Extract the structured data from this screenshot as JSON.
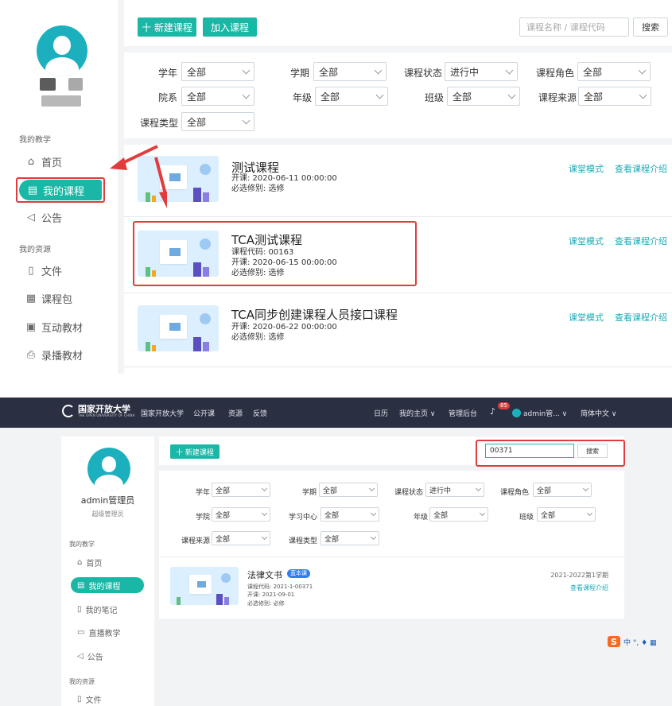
{
  "top": {
    "sidebar": {
      "section_teaching": "我的教学",
      "items": [
        {
          "label": "首页",
          "icon": "home-icon"
        },
        {
          "label": "我的课程",
          "icon": "course-icon",
          "active": true
        },
        {
          "label": "公告",
          "icon": "announcement-icon"
        }
      ],
      "section_resources": "我的资源",
      "resource_items": [
        {
          "label": "文件",
          "icon": "file-icon"
        },
        {
          "label": "课程包",
          "icon": "package-icon"
        },
        {
          "label": "互动教材",
          "icon": "interactive-icon"
        },
        {
          "label": "录播教材",
          "icon": "recording-icon"
        }
      ]
    },
    "toolbar": {
      "new_course": "十 新建课程",
      "join_course": "加入课程",
      "search_placeholder": "课程名称 / 课程代码",
      "search_btn": "搜索"
    },
    "filters": {
      "year_label": "学年",
      "year_value": "全部",
      "term_label": "学期",
      "term_value": "全部",
      "status_label": "课程状态",
      "status_value": "进行中",
      "role_label": "课程角色",
      "role_value": "全部",
      "dept_label": "院系",
      "dept_value": "全部",
      "grade_label": "年级",
      "grade_value": "全部",
      "class_label": "班级",
      "class_value": "全部",
      "source_label": "课程来源",
      "source_value": "全部",
      "type_label": "课程类型",
      "type_value": "全部"
    },
    "courses": [
      {
        "title": "测试课程",
        "code": "",
        "start": "开课: 2020-06-11 00:00:00",
        "required": "必选修别: 选修"
      },
      {
        "title": "TCA测试课程",
        "code": "课程代码: 00163",
        "start": "开课: 2020-06-15 00:00:00",
        "required": "必选修别: 选修"
      },
      {
        "title": "TCA同步创建课程人员接口课程",
        "code": "",
        "start": "开课: 2020-06-22 00:00:00",
        "required": "必选修别: 选修"
      }
    ],
    "links": {
      "classroom": "课堂模式",
      "intro": "查看课程介绍"
    }
  },
  "bottom": {
    "nav": {
      "logo": "国家开放大学",
      "logo_sub": "THE OPEN UNIVERSITY OF CHINA",
      "links": [
        "国家开放大学",
        "公开课",
        "资源",
        "反馈"
      ],
      "calendar": "日历",
      "my_home": "我的主页 ∨",
      "admin_backend": "管理后台",
      "badge": "85",
      "user": "admin管... ∨",
      "lang": "简体中文 ∨"
    },
    "profile": {
      "name": "admin管理员",
      "role": "超级管理员"
    },
    "sidebar": {
      "section_teaching": "我的教学",
      "items": [
        {
          "label": "首页"
        },
        {
          "label": "我的课程"
        },
        {
          "label": "我的笔记"
        },
        {
          "label": "直播教学"
        },
        {
          "label": "公告"
        }
      ],
      "section_resources": "我的资源",
      "resource_items": [
        {
          "label": "文件"
        }
      ]
    },
    "toolbar": {
      "new_course": "十 新建课程",
      "search_value": "00371",
      "search_btn": "搜索"
    },
    "filters": {
      "year_label": "学年",
      "year_value": "全部",
      "term_label": "学期",
      "term_value": "全部",
      "status_label": "课程状态",
      "status_value": "进行中",
      "role_label": "课程角色",
      "role_value": "全部",
      "college_label": "学院",
      "college_value": "全部",
      "center_label": "学习中心",
      "center_value": "全部",
      "grade_label": "年级",
      "grade_value": "全部",
      "class_label": "班级",
      "class_value": "全部",
      "source_label": "课程来源",
      "source_value": "全部",
      "type_label": "课程类型",
      "type_value": "全部"
    },
    "course": {
      "title": "法律文书",
      "tag": "蓝本课",
      "code": "课程代码: 2021-1-00371",
      "start": "开课: 2021-09-01",
      "required": "必选修别: 必修",
      "term": "2021-2022第1学期",
      "intro": "查看课程介绍"
    },
    "ime": "中 °, ♦ ▦"
  },
  "colors": {
    "accent": "#1ab7a6",
    "highlight": "#e23b3b",
    "nav_bg": "#2a3042"
  }
}
